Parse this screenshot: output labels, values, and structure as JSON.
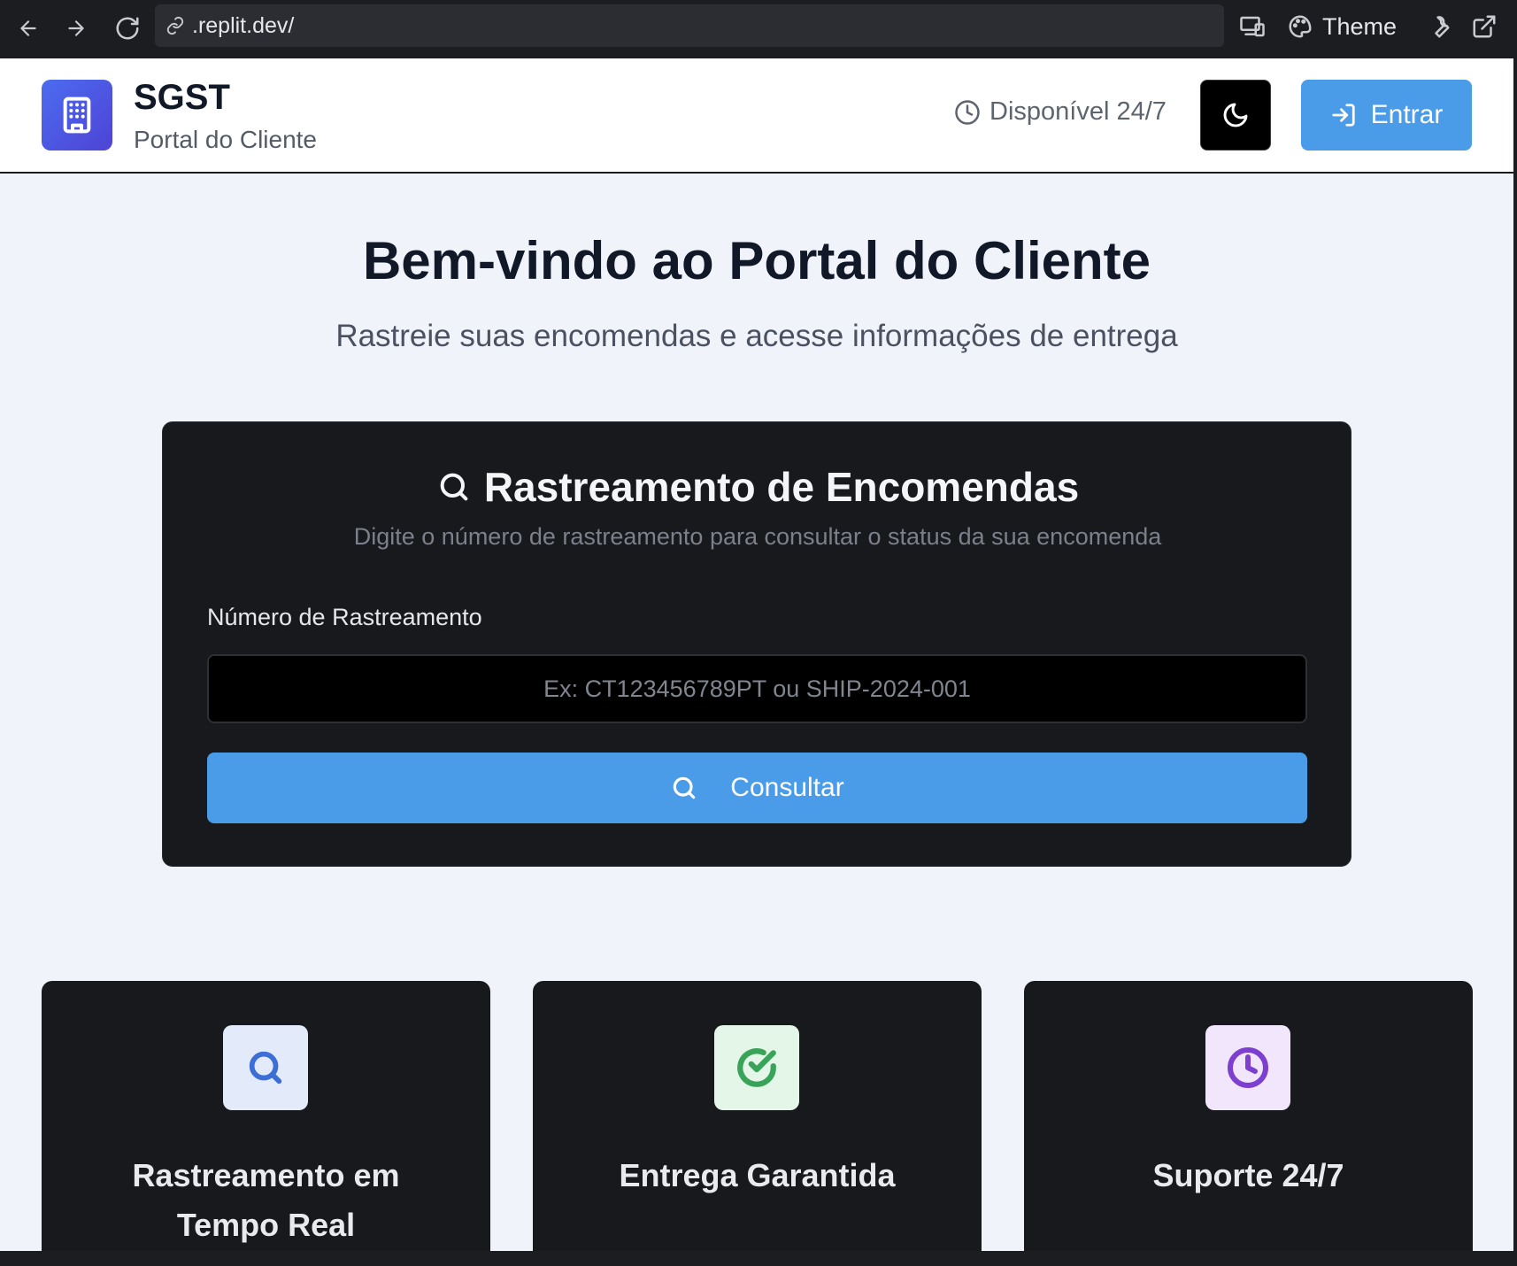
{
  "browser": {
    "url": ".replit.dev/",
    "theme_label": "Theme"
  },
  "header": {
    "brand_name": "SGST",
    "brand_subtitle": "Portal do Cliente",
    "availability": "Disponível 24/7",
    "login_label": "Entrar"
  },
  "hero": {
    "title": "Bem-vindo ao Portal do Cliente",
    "subtitle": "Rastreie suas encomendas e acesse informações de entrega"
  },
  "tracking": {
    "title": "Rastreamento de Encomendas",
    "description": "Digite o número de rastreamento para consultar o status da sua encomenda",
    "field_label": "Número de Rastreamento",
    "placeholder": "Ex: CT123456789PT ou SHIP-2024-001",
    "value": "",
    "button_label": "Consultar"
  },
  "features": [
    {
      "title": "Rastreamento em Tempo Real",
      "icon": "search-icon",
      "icon_color": "#3b6fd6",
      "icon_bg": "#e3ebfb"
    },
    {
      "title": "Entrega Garantida",
      "icon": "check-circle-icon",
      "icon_color": "#3aa35a",
      "icon_bg": "#e3f6e7"
    },
    {
      "title": "Suporte 24/7",
      "icon": "clock-icon",
      "icon_color": "#7d3fd0",
      "icon_bg": "#f1e6fb"
    }
  ],
  "colors": {
    "primary": "#4a9be8",
    "card_bg": "#18191d",
    "page_bg": "#f1f3fb"
  }
}
